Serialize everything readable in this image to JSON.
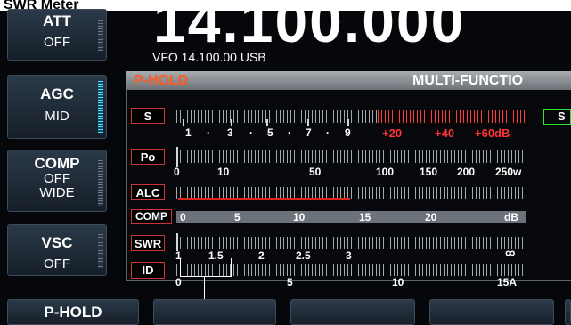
{
  "figure_caption": "SWR Meter",
  "left_buttons": [
    {
      "line1": "ATT",
      "line2": "OFF",
      "line3": ""
    },
    {
      "line1": "AGC",
      "line2": "MID",
      "line3": ""
    },
    {
      "line1": "COMP",
      "line2": "OFF",
      "line3": "WIDE"
    },
    {
      "line1": "VSC",
      "line2": "OFF",
      "line3": ""
    }
  ],
  "frequency": "14.100.000",
  "vfo_line": "VFO 14.100.00 USB",
  "meter_header": {
    "left": "P-HOLD",
    "right": "MULTI-FUNCTIO"
  },
  "right_partial_label": "S",
  "meters": {
    "s_label": "S",
    "s_ticks": [
      "1",
      "3",
      "5",
      "7",
      "9"
    ],
    "s_red_ticks": [
      "+20",
      "+40",
      "+60dB"
    ],
    "po_label": "Po",
    "po_ticks": [
      "0",
      "10",
      "50",
      "100",
      "150",
      "200",
      "250w"
    ],
    "alc_label": "ALC",
    "comp_label": "COMP",
    "comp_ticks": [
      "0",
      "5",
      "10",
      "15",
      "20",
      "dB"
    ],
    "swr_label": "SWR",
    "swr_ticks": [
      "1",
      "1.5",
      "2",
      "2.5",
      "3",
      "∞"
    ],
    "id_label": "ID",
    "id_ticks": [
      "0",
      "5",
      "10",
      "15A"
    ],
    "dot": "·"
  },
  "softkeys": {
    "first": "P-HOLD"
  },
  "colors": {
    "accent_orange": "#ff5a1e",
    "alc_bar": "#e0241e",
    "grip_cyan": "#4fe1ff",
    "s_box_green": "#2fe02f"
  }
}
